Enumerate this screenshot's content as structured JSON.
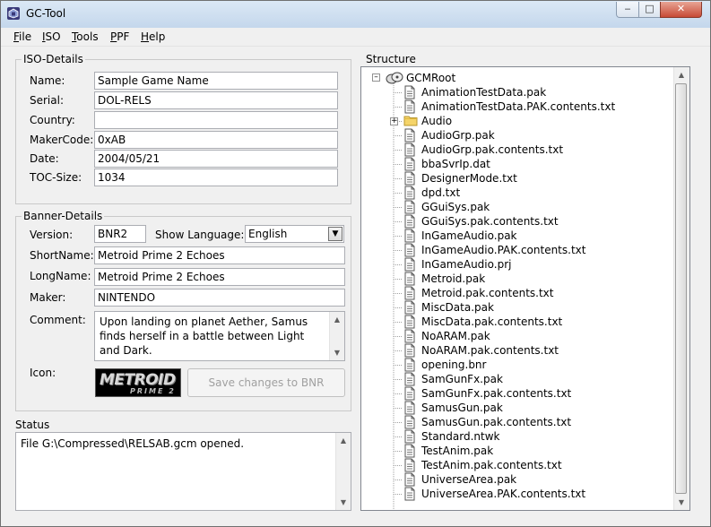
{
  "window": {
    "title": "GC-Tool"
  },
  "menu": [
    {
      "label": "File",
      "key": "F"
    },
    {
      "label": "ISO",
      "key": "I"
    },
    {
      "label": "Tools",
      "key": "T"
    },
    {
      "label": "PPF",
      "key": "P"
    },
    {
      "label": "Help",
      "key": "H"
    }
  ],
  "iso": {
    "group_label": "ISO-Details",
    "name_label": "Name:",
    "name": "Sample Game Name",
    "serial_label": "Serial:",
    "serial": "DOL-RELS",
    "country_label": "Country:",
    "country": "",
    "maker_label": "MakerCode:",
    "maker": "0xAB",
    "date_label": "Date:",
    "date": "2004/05/21",
    "toc_label": "TOC-Size:",
    "toc": "1034"
  },
  "banner": {
    "group_label": "Banner-Details",
    "version_label": "Version:",
    "version": "BNR2",
    "show_language_label": "Show Language:",
    "language": "English",
    "shortname_label": "ShortName:",
    "shortname": "Metroid Prime 2 Echoes",
    "longname_label": "LongName:",
    "longname": "Metroid Prime 2 Echoes",
    "maker_label": "Maker:",
    "maker": "NINTENDO",
    "comment_label": "Comment:",
    "comment": "Upon landing on planet Aether, Samus finds herself in a battle between Light and Dark.",
    "icon_label": "Icon:",
    "icon_logo_text": "METROID",
    "icon_logo_sub": "PRIME 2",
    "save_button": "Save changes to BNR"
  },
  "status": {
    "group_label": "Status",
    "text": "File G:\\Compressed\\RELSAB.gcm opened."
  },
  "structure": {
    "group_label": "Structure",
    "root": "GCMRoot",
    "items": [
      {
        "name": "AnimationTestData.pak",
        "type": "file"
      },
      {
        "name": "AnimationTestData.PAK.contents.txt",
        "type": "file"
      },
      {
        "name": "Audio",
        "type": "folder"
      },
      {
        "name": "AudioGrp.pak",
        "type": "file"
      },
      {
        "name": "AudioGrp.pak.contents.txt",
        "type": "file"
      },
      {
        "name": "bbaSvrIp.dat",
        "type": "file"
      },
      {
        "name": "DesignerMode.txt",
        "type": "file"
      },
      {
        "name": "dpd.txt",
        "type": "file"
      },
      {
        "name": "GGuiSys.pak",
        "type": "file"
      },
      {
        "name": "GGuiSys.pak.contents.txt",
        "type": "file"
      },
      {
        "name": "InGameAudio.pak",
        "type": "file"
      },
      {
        "name": "InGameAudio.PAK.contents.txt",
        "type": "file"
      },
      {
        "name": "InGameAudio.prj",
        "type": "file"
      },
      {
        "name": "Metroid.pak",
        "type": "file"
      },
      {
        "name": "Metroid.pak.contents.txt",
        "type": "file"
      },
      {
        "name": "MiscData.pak",
        "type": "file"
      },
      {
        "name": "MiscData.pak.contents.txt",
        "type": "file"
      },
      {
        "name": "NoARAM.pak",
        "type": "file"
      },
      {
        "name": "NoARAM.pak.contents.txt",
        "type": "file"
      },
      {
        "name": "opening.bnr",
        "type": "file"
      },
      {
        "name": "SamGunFx.pak",
        "type": "file"
      },
      {
        "name": "SamGunFx.pak.contents.txt",
        "type": "file"
      },
      {
        "name": "SamusGun.pak",
        "type": "file"
      },
      {
        "name": "SamusGun.pak.contents.txt",
        "type": "file"
      },
      {
        "name": "Standard.ntwk",
        "type": "file"
      },
      {
        "name": "TestAnim.pak",
        "type": "file"
      },
      {
        "name": "TestAnim.pak.contents.txt",
        "type": "file"
      },
      {
        "name": "UniverseArea.pak",
        "type": "file"
      },
      {
        "name": "UniverseArea.PAK.contents.txt",
        "type": "file"
      }
    ]
  }
}
